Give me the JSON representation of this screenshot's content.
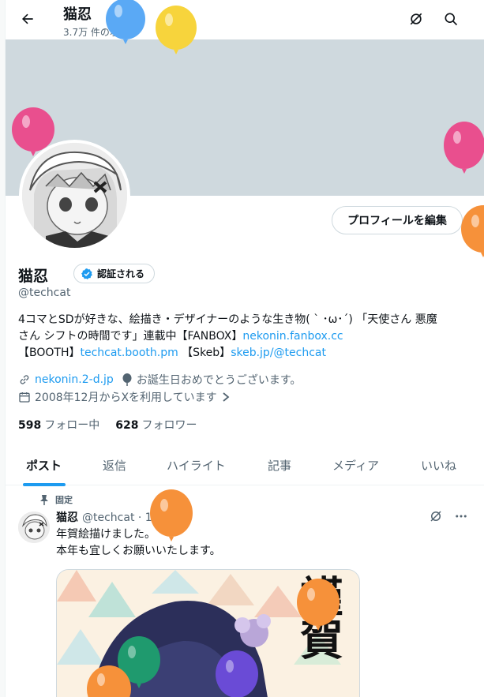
{
  "header": {
    "title": "猫忍",
    "post_count": "3.7万 件のポスト"
  },
  "profile": {
    "edit_button": "プロフィールを編集",
    "name": "猫忍",
    "verify_label": "認証される",
    "handle": "@techcat",
    "bio_line1": "4コマとSDが好きな、絵描き・デザイナーのような生き物( ` ･ω･´) 「天使さん 悪魔",
    "bio_line2_text": "さん シフトの時間です」連載中【FANBOX】",
    "bio_link_fanbox": "nekonin.fanbox.cc",
    "bio_booth_label": "【BOOTH】",
    "bio_link_booth": "techcat.booth.pm",
    "bio_skeb_label": " 【Skeb】",
    "bio_link_skeb": "skeb.jp/@techcat",
    "website": "nekonin.2-d.jp",
    "birthday": "お誕生日おめでとうございます。",
    "joined": "2008年12月からXを利用しています",
    "following_count": "598",
    "following_label": "フォロー中",
    "followers_count": "628",
    "followers_label": "フォロワー"
  },
  "tabs": [
    "ポスト",
    "返信",
    "ハイライト",
    "記事",
    "メディア",
    "いいね"
  ],
  "post": {
    "pinned_label": "固定",
    "author": "猫忍",
    "meta": "@techcat · 1月7日",
    "line1": "年賀絵描けました。",
    "line2": "本年も宜しくお願いいたします。",
    "image_text": "謹賀"
  },
  "colors": {
    "accent": "#1d9bf0",
    "banner": "#cfd9de",
    "balloon_blue": "#5aa9f5",
    "balloon_yellow": "#f7d43c",
    "balloon_pink": "#e94f8e",
    "balloon_orange": "#f6913a",
    "balloon_green": "#1f9a6e",
    "balloon_purple": "#6a4bd6"
  }
}
